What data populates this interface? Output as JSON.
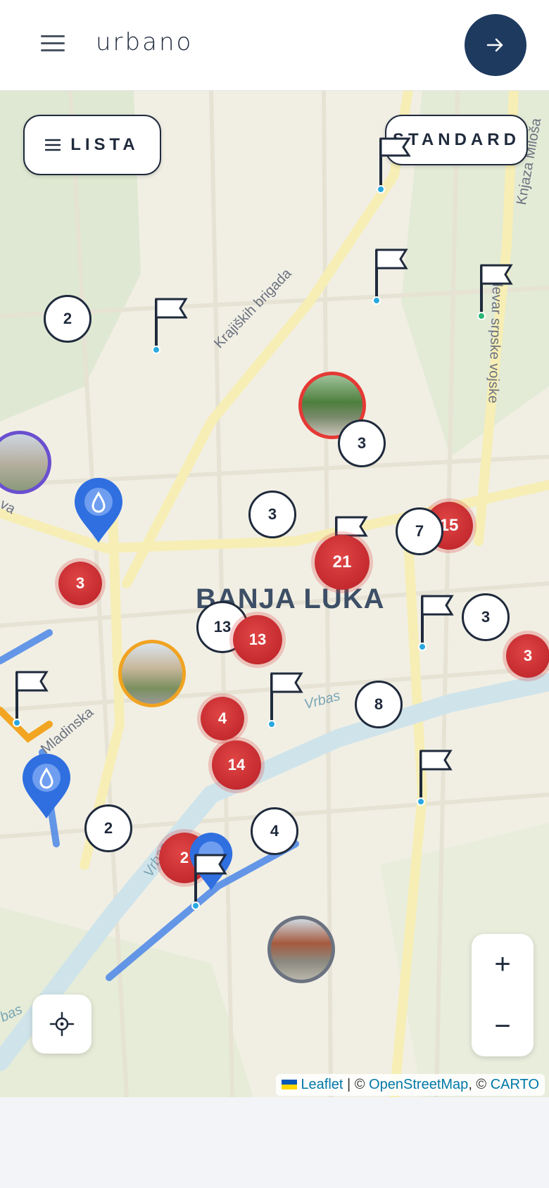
{
  "header": {
    "logo": "urbano",
    "menu_icon": "hamburger-icon",
    "action_icon": "arrow-right-icon"
  },
  "map": {
    "list_button": "LISTA",
    "style_button": "STANDARD",
    "city": "BANJA LUKA",
    "roads": {
      "r1": "Krajiških brigada",
      "r2": "Bulevar srpske vojske",
      "r3": "Knjaza Miloša",
      "r4": "Vrbas",
      "r5": "Mladinska",
      "r6": "Vrbas",
      "r7": "va",
      "r8": "bas"
    },
    "clusters": {
      "c1": "2",
      "c2": "3",
      "c3": "3",
      "c4": "7",
      "c5": "15",
      "c6": "21",
      "c7": "3",
      "c8": "13",
      "c9": "13",
      "c10": "3",
      "c11": "3",
      "c12": "8",
      "c13": "4",
      "c14": "14",
      "c15": "2",
      "c16": "4",
      "c17": "2"
    },
    "zoom_in": "+",
    "zoom_out": "−",
    "attribution": {
      "leaflet": "Leaflet",
      "sep1": " | © ",
      "osm": "OpenStreetMap",
      "sep2": ", © ",
      "carto": "CARTO"
    }
  },
  "colors": {
    "primary": "#1e3a5f",
    "cluster_red": "#c62828",
    "pin_blue": "#2f6fe0",
    "road_yellow": "#f5e9a8"
  }
}
